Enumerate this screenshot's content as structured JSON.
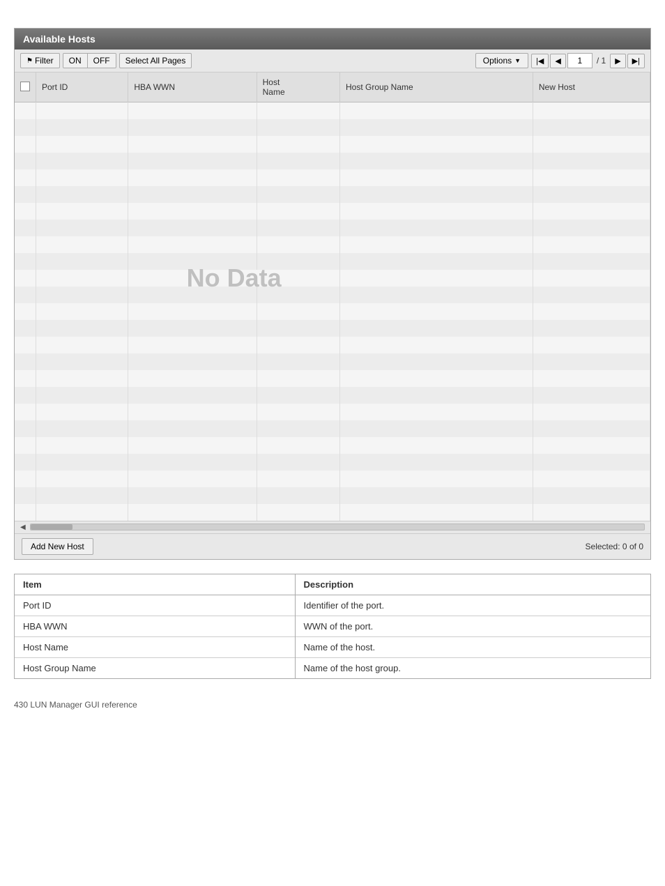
{
  "panel": {
    "title": "Available Hosts",
    "toolbar": {
      "filter_label": "Filter",
      "on_label": "ON",
      "off_label": "OFF",
      "select_all_label": "Select All Pages",
      "options_label": "Options",
      "page_current": "1",
      "page_total": "/ 1"
    },
    "table": {
      "columns": [
        "",
        "Port ID",
        "HBA WWN",
        "Host Name",
        "Host Group Name",
        "New Host"
      ],
      "no_data_text": "No Data",
      "rows": []
    },
    "footer": {
      "add_new_host_label": "Add New Host",
      "selected_label": "Selected:",
      "selected_count": "0",
      "of_label": "of",
      "total_count": "0"
    }
  },
  "desc_table": {
    "columns": [
      "Item",
      "Description"
    ],
    "rows": [
      {
        "item": "Port ID",
        "description": "Identifier of the port."
      },
      {
        "item": "HBA WWN",
        "description": "WWN of the port."
      },
      {
        "item": "Host Name",
        "description": "Name of the host."
      },
      {
        "item": "Host Group Name",
        "description": "Name of the host group."
      }
    ]
  },
  "page_footer": {
    "text": "430   LUN Manager GUI reference"
  }
}
